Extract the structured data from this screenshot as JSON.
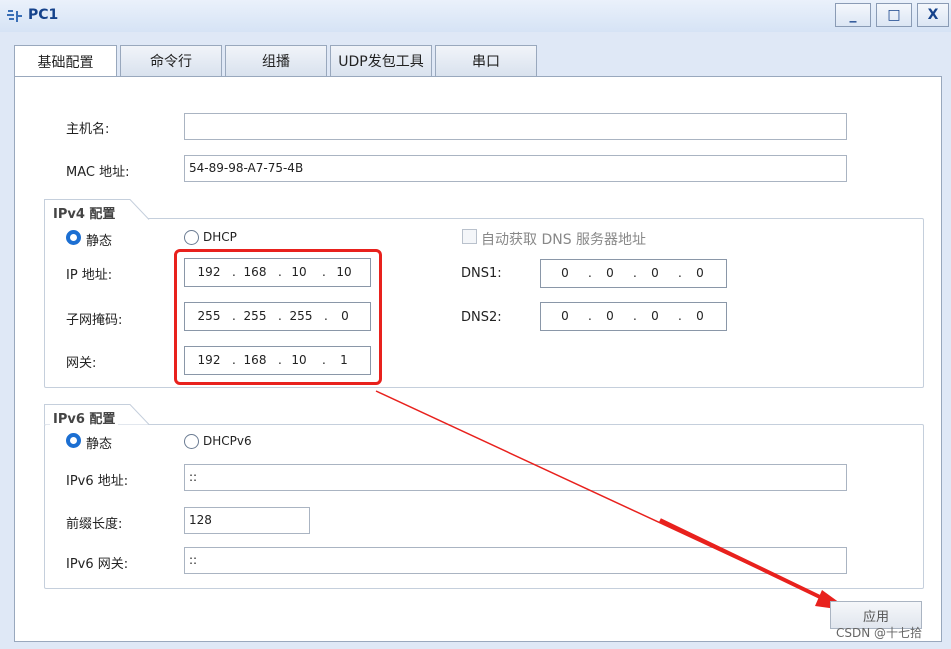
{
  "window": {
    "title": "PC1",
    "minimize": "_",
    "maximize": "□",
    "close": "X"
  },
  "tabs": [
    {
      "label": "基础配置",
      "active": true
    },
    {
      "label": "命令行"
    },
    {
      "label": "组播"
    },
    {
      "label": "UDP发包工具"
    },
    {
      "label": "串口"
    }
  ],
  "basic": {
    "hostname_label": "主机名:",
    "hostname_value": "",
    "mac_label": "MAC 地址:",
    "mac_value": "54-89-98-A7-75-4B"
  },
  "ipv4": {
    "group_title": "IPv4 配置",
    "static_label": "静态",
    "dhcp_label": "DHCP",
    "mode": "static",
    "auto_dns_label": "自动获取 DNS 服务器地址",
    "ip_label": "IP 地址:",
    "ip": [
      "192",
      "168",
      "10",
      "10"
    ],
    "mask_label": "子网掩码:",
    "mask": [
      "255",
      "255",
      "255",
      "0"
    ],
    "gateway_label": "网关:",
    "gateway": [
      "192",
      "168",
      "10",
      "1"
    ],
    "dns1_label": "DNS1:",
    "dns1": [
      "0",
      "0",
      "0",
      "0"
    ],
    "dns2_label": "DNS2:",
    "dns2": [
      "0",
      "0",
      "0",
      "0"
    ]
  },
  "ipv6": {
    "group_title": "IPv6 配置",
    "static_label": "静态",
    "dhcp_label": "DHCPv6",
    "mode": "static",
    "addr_label": "IPv6 地址:",
    "addr_value": "::",
    "prefix_label": "前缀长度:",
    "prefix_value": "128",
    "gateway_label": "IPv6 网关:",
    "gateway_value": "::"
  },
  "apply_label": "应用",
  "watermark": "CSDN @十七拾",
  "colors": {
    "accent": "#1c6fd2",
    "highlight": "#e8211d"
  }
}
